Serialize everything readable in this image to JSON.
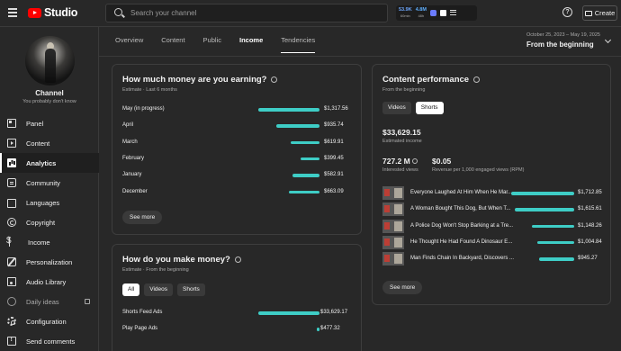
{
  "topbar": {
    "logo_text": "Studio",
    "search_placeholder": "Search your channel",
    "stats": [
      {
        "value": "53.9K",
        "label": "60min"
      },
      {
        "value": "4.8M",
        "label": "48h"
      }
    ],
    "create_label": "Create",
    "help_glyph": "?"
  },
  "sidebar": {
    "channel_name": "Channel",
    "channel_sub": "You probably don't know",
    "items": [
      {
        "label": "Panel",
        "icon": "dashboard-icon"
      },
      {
        "label": "Content",
        "icon": "content-icon"
      },
      {
        "label": "Analytics",
        "icon": "analytics-icon"
      },
      {
        "label": "Community",
        "icon": "community-icon"
      },
      {
        "label": "Languages",
        "icon": "languages-icon"
      },
      {
        "label": "Copyright",
        "icon": "copyright-icon"
      },
      {
        "label": "Income",
        "icon": "income-icon"
      },
      {
        "label": "Personalization",
        "icon": "customization-icon"
      },
      {
        "label": "Audio Library",
        "icon": "audio-library-icon"
      },
      {
        "label": "Daily ideas",
        "icon": "ideas-icon"
      },
      {
        "label": "Configuration",
        "icon": "settings-icon"
      },
      {
        "label": "Send comments",
        "icon": "feedback-icon"
      }
    ]
  },
  "tabs": [
    "Overview",
    "Content",
    "Public",
    "Income",
    "Tendencies"
  ],
  "date_range": {
    "dates": "October 25, 2023 – May 19, 2025",
    "label": "From the beginning"
  },
  "earnings_card": {
    "title": "How much money are you earning?",
    "subtitle": "Estimate · Last 6 months",
    "rows": [
      {
        "month": "May (in progress)",
        "amount": "$1,317.56",
        "value": 1317.56
      },
      {
        "month": "April",
        "amount": "$935.74",
        "value": 935.74
      },
      {
        "month": "March",
        "amount": "$619.91",
        "value": 619.91
      },
      {
        "month": "February",
        "amount": "$399.45",
        "value": 399.45
      },
      {
        "month": "January",
        "amount": "$582.91",
        "value": 582.91
      },
      {
        "month": "December",
        "amount": "$663.09",
        "value": 663.09
      }
    ],
    "see_more": "See more"
  },
  "sources_card": {
    "title": "How do you make money?",
    "subtitle": "Estimate · From the beginning",
    "chips": [
      "All",
      "Videos",
      "Shorts"
    ],
    "rows": [
      {
        "source": "Shorts Feed Ads",
        "amount": "$33,629.17",
        "value": 33629.17
      },
      {
        "source": "Play Page Ads",
        "amount": "$477.32",
        "value": 477.32
      }
    ]
  },
  "performance_card": {
    "title": "Content performance",
    "subtitle": "From the beginning",
    "chips": [
      "Videos",
      "Shorts"
    ],
    "income_value": "$33,629.15",
    "income_label": "Estimated income",
    "views_value": "727.2 M",
    "views_label": "Interested views",
    "rpm_value": "$0.05",
    "rpm_label": "Revenue per 1,000 engaged views (RPM)",
    "videos": [
      {
        "title": "Everyone Laughed At Him When He Mar...",
        "amount": "$1,712.85",
        "value": 1712.85
      },
      {
        "title": "A Woman Bought This Dog, But When T...",
        "amount": "$1,615.61",
        "value": 1615.61
      },
      {
        "title": "A Police Dog Won't Stop Barking at a Tre...",
        "amount": "$1,148.26",
        "value": 1148.26
      },
      {
        "title": "He Thought He Had Found A Dinosaur E...",
        "amount": "$1,004.84",
        "value": 1004.84
      },
      {
        "title": "Man Finds Chain In Backyard, Discovers ...",
        "amount": "$945.27",
        "value": 945.27
      }
    ],
    "see_more": "See more"
  },
  "colors": {
    "accent": "#3ecdc6",
    "brand": "#ff0000",
    "background": "#282828"
  }
}
